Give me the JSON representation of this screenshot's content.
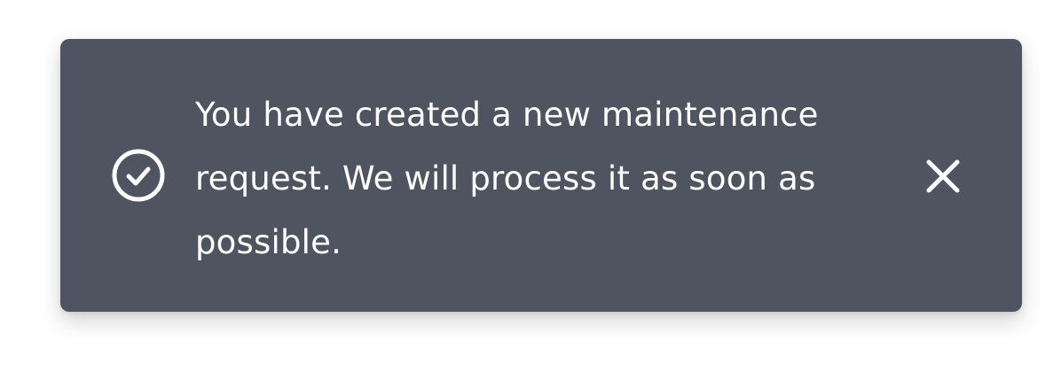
{
  "toast": {
    "message": "You have created a new maintenance request. We will process it as soon as possible.",
    "status_icon": "check-circle-icon",
    "close_icon": "close-icon",
    "background_color": "#4f5461",
    "text_color": "#ffffff"
  }
}
